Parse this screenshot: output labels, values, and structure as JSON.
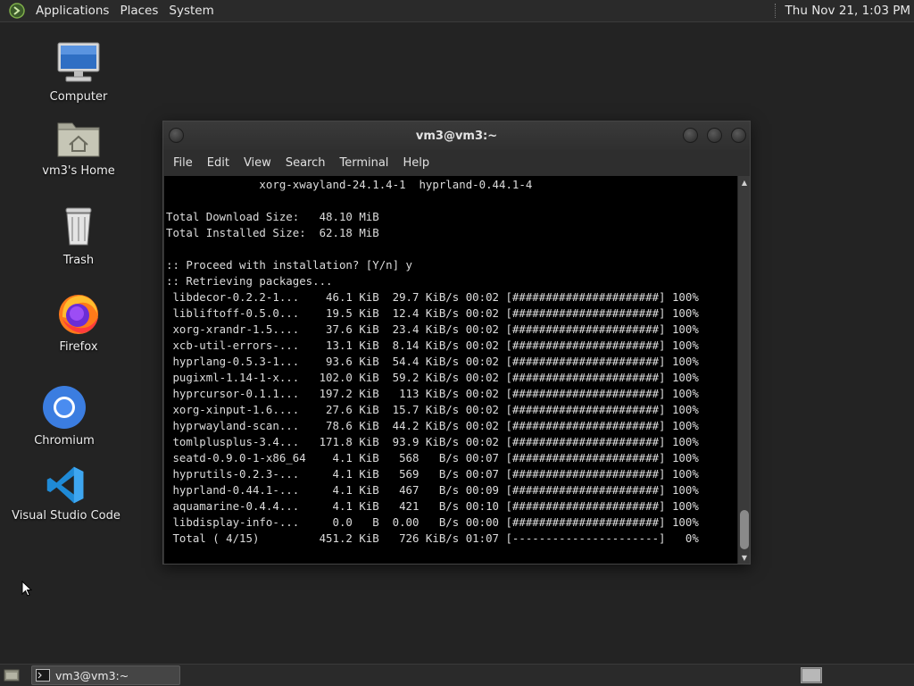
{
  "top_panel": {
    "menus": [
      "Applications",
      "Places",
      "System"
    ],
    "clock": "Thu Nov 21,  1:03 PM"
  },
  "desktop_icons": [
    {
      "label": "Computer",
      "icon": "computer-icon"
    },
    {
      "label": "vm3's Home",
      "icon": "home-folder-icon"
    },
    {
      "label": "Trash",
      "icon": "trash-icon"
    },
    {
      "label": "Firefox",
      "icon": "firefox-icon"
    },
    {
      "label": "Chromium",
      "icon": "chromium-icon"
    },
    {
      "label": "Visual Studio Code",
      "icon": "vscode-icon"
    }
  ],
  "terminal": {
    "title": "vm3@vm3:~",
    "menu": [
      "File",
      "Edit",
      "View",
      "Search",
      "Terminal",
      "Help"
    ],
    "lines": [
      "              xorg-xwayland-24.1.4-1  hyprland-0.44.1-4",
      "",
      "Total Download Size:   48.10 MiB",
      "Total Installed Size:  62.18 MiB",
      "",
      ":: Proceed with installation? [Y/n] y",
      ":: Retrieving packages...",
      " libdecor-0.2.2-1...    46.1 KiB  29.7 KiB/s 00:02 [######################] 100%",
      " libliftoff-0.5.0...    19.5 KiB  12.4 KiB/s 00:02 [######################] 100%",
      " xorg-xrandr-1.5....    37.6 KiB  23.4 KiB/s 00:02 [######################] 100%",
      " xcb-util-errors-...    13.1 KiB  8.14 KiB/s 00:02 [######################] 100%",
      " hyprlang-0.5.3-1...    93.6 KiB  54.4 KiB/s 00:02 [######################] 100%",
      " pugixml-1.14-1-x...   102.0 KiB  59.2 KiB/s 00:02 [######################] 100%",
      " hyprcursor-0.1.1...   197.2 KiB   113 KiB/s 00:02 [######################] 100%",
      " xorg-xinput-1.6....    27.6 KiB  15.7 KiB/s 00:02 [######################] 100%",
      " hyprwayland-scan...    78.6 KiB  44.2 KiB/s 00:02 [######################] 100%",
      " tomlplusplus-3.4...   171.8 KiB  93.9 KiB/s 00:02 [######################] 100%",
      " seatd-0.9.0-1-x86_64    4.1 KiB   568   B/s 00:07 [######################] 100%",
      " hyprutils-0.2.3-...     4.1 KiB   569   B/s 00:07 [######################] 100%",
      " hyprland-0.44.1-...     4.1 KiB   467   B/s 00:09 [######################] 100%",
      " aquamarine-0.4.4...     4.1 KiB   421   B/s 00:10 [######################] 100%",
      " libdisplay-info-...     0.0   B  0.00   B/s 00:00 [######################] 100%",
      " Total ( 4/15)         451.2 KiB   726 KiB/s 01:07 [----------------------]   0%"
    ]
  },
  "taskbar": {
    "task_label": "vm3@vm3:~"
  }
}
